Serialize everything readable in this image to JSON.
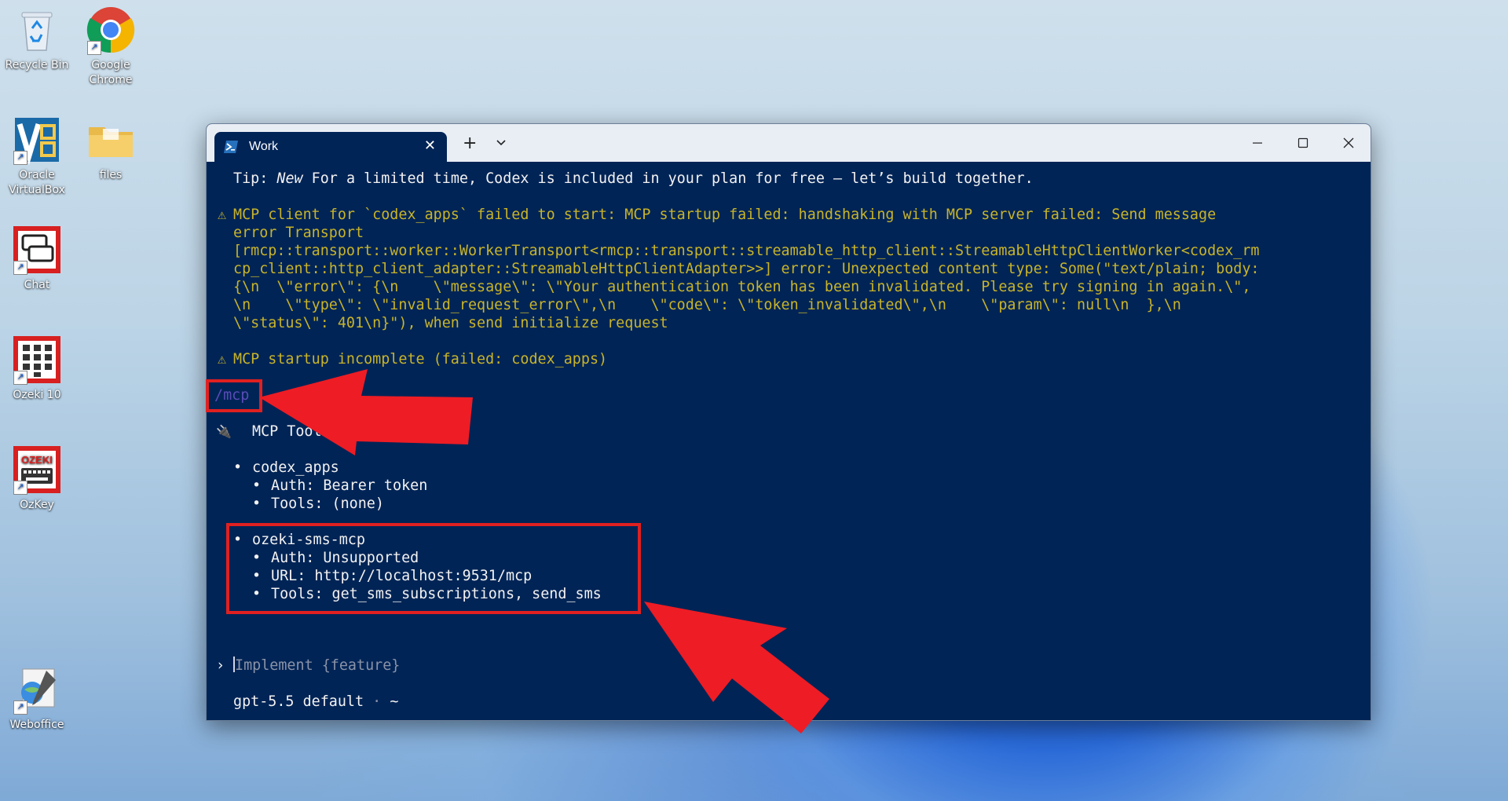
{
  "desktop": {
    "icons": [
      {
        "id": "recycle-bin",
        "label": "Recycle Bin"
      },
      {
        "id": "google-chrome",
        "label": "Google Chrome"
      },
      {
        "id": "oracle-virtualbox",
        "label": "Oracle VirtualBox"
      },
      {
        "id": "files",
        "label": "files"
      },
      {
        "id": "chat",
        "label": "Chat"
      },
      {
        "id": "ozeki-10",
        "label": "Ozeki 10"
      },
      {
        "id": "ozkey",
        "label": "OzKey"
      },
      {
        "id": "weboffice",
        "label": "Weboffice"
      }
    ]
  },
  "window": {
    "tab_title": "Work",
    "tab_close": "✕",
    "new_tab": "+",
    "icons": {
      "tab": "powershell-icon",
      "minimize": "minimize-icon",
      "maximize": "maximize-icon",
      "close": "close-icon"
    }
  },
  "terminal": {
    "tip_prefix": "Tip: ",
    "tip_new": "New",
    "tip_rest": " For a limited time, Codex is included in your plan for free – let’s build together.",
    "warn_icon": "⚠",
    "error_lines": [
      "MCP client for `codex_apps` failed to start: MCP startup failed: handshaking with MCP server failed: Send message",
      "error Transport",
      "[rmcp::transport::worker::WorkerTransport<rmcp::transport::streamable_http_client::StreamableHttpClientWorker<codex_rm",
      "cp_client::http_client_adapter::StreamableHttpClientAdapter>>] error: Unexpected content type: Some(\"text/plain; body:",
      "{\\n  \\\"error\\\": {\\n    \\\"message\\\": \\\"Your authentication token has been invalidated. Please try signing in again.\\\",",
      "\\n    \\\"type\\\": \\\"invalid_request_error\\\",\\n    \\\"code\\\": \\\"token_invalidated\\\",\\n    \\\"param\\\": null\\n  },\\n",
      "\\\"status\\\": 401\\n}\"), when send initialize request"
    ],
    "incomplete": "MCP startup incomplete (failed: codex_apps)",
    "command": "/mcp",
    "tools_icon": "🔌",
    "tools_header": "MCP Tools",
    "servers": [
      {
        "name": "codex_apps",
        "details": [
          "Auth: Bearer token",
          "Tools: (none)"
        ]
      },
      {
        "name": "ozeki-sms-mcp",
        "details": [
          "Auth: Unsupported",
          "URL: http://localhost:9531/mcp",
          "Tools: get_sms_subscriptions, send_sms"
        ]
      }
    ],
    "bullet": "•",
    "prompt_symbol": "›",
    "input_placeholder": "Implement {feature}",
    "model": "gpt-5.5 default",
    "sep": "·",
    "cwd": "~"
  },
  "colors": {
    "terminal_bg": "#012456",
    "warning": "#c8b42a",
    "highlight": "#e02020"
  }
}
